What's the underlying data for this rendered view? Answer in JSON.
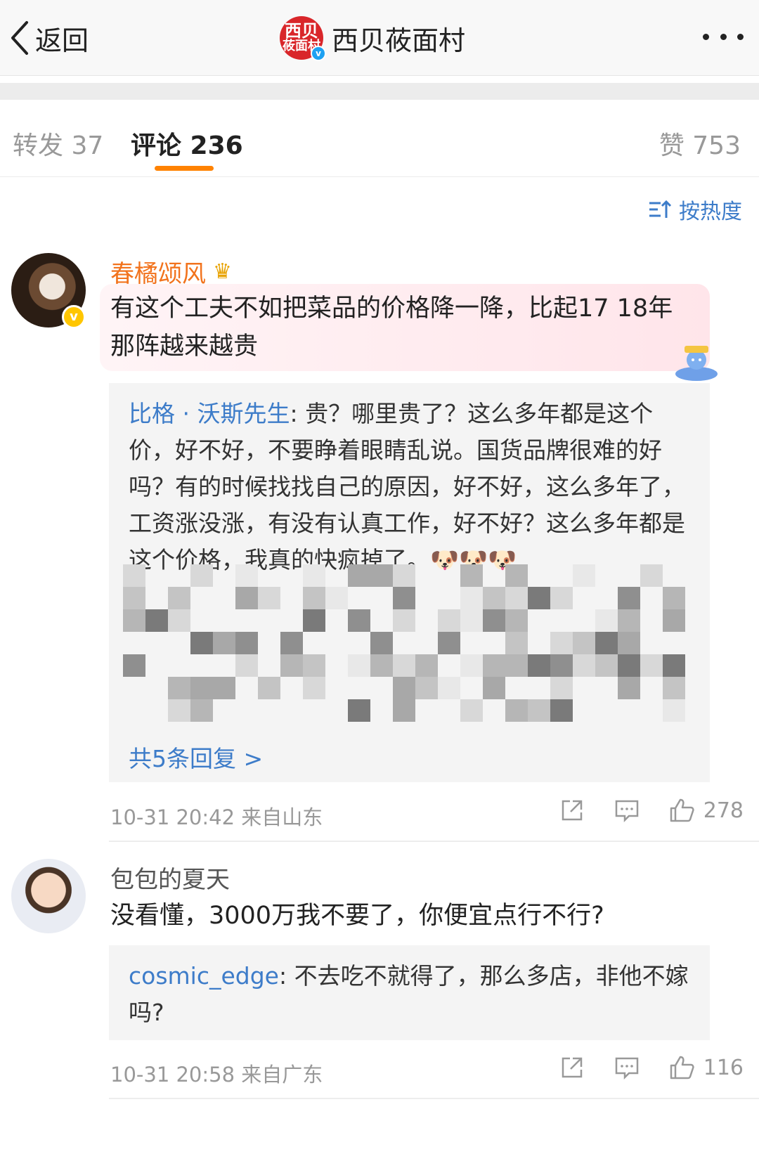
{
  "header": {
    "back_label": "返回",
    "title": "西贝莜面村",
    "logo_line1": "西贝",
    "logo_line2": "莜面村",
    "verified_mark": "v"
  },
  "tabs": {
    "repost": "转发 37",
    "comment": "评论 236",
    "like": "赞 753"
  },
  "sort_label": "按热度",
  "comments": [
    {
      "username": "春橘颂风",
      "verified_mark": "v",
      "text": "有这个工夫不如把菜品的价格降一降，比起17 18年那阵越来越贵",
      "reply": {
        "author": "比格 · 沃斯先生",
        "text": ": 贵？哪里贵了？这么多年都是这个价，好不好，不要睁着眼睛乱说。国货品牌很难的好吗？有的时候找找自己的原因，好不好，这么多年了，工资涨没涨，有没有认真工作，好不好？这么多年都是这个价格，我真的快疯掉了。",
        "emoji": "🐶🐶🐶"
      },
      "more_replies": "共5条回复 >",
      "time": "10-31 20:42",
      "location": "来自山东",
      "likes": "278"
    },
    {
      "username": "包包的夏天",
      "text": "没看懂，3000万我不要了，你便宜点行不行?",
      "reply": {
        "author": "cosmic_edge",
        "text": ": 不去吃不就得了，那么多店，非他不嫁吗?"
      },
      "time": "10-31 20:58",
      "location": "来自广东",
      "likes": "116"
    }
  ],
  "colors": {
    "accent_orange": "#ff8200",
    "link_blue": "#3d7cc9",
    "vip_name_orange": "#f2731d",
    "verified_gold": "#ffc600",
    "brand_red": "#d9262a"
  },
  "icons": [
    "back-arrow-icon",
    "more-dots-icon",
    "sort-icon",
    "share-icon",
    "comment-icon",
    "like-icon",
    "crown-icon"
  ]
}
